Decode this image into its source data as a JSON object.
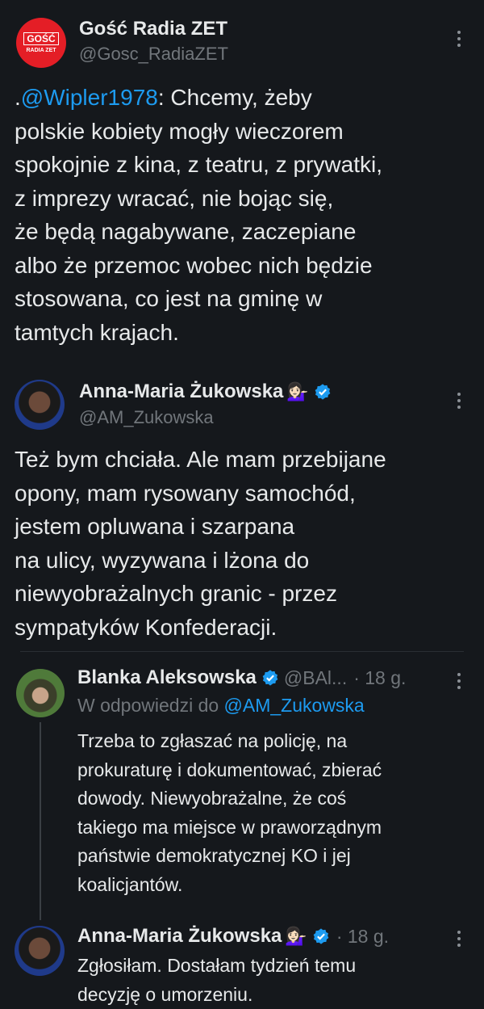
{
  "colors": {
    "background": "#15181c",
    "text": "#e7e9ea",
    "secondary": "#71767b",
    "accent": "#1d9bf0"
  },
  "tweet1": {
    "avatar_text_top": "GOŚĆ",
    "avatar_text_bottom": "RADIA ZET",
    "display_name": "Gość Radia ZET",
    "handle": "@Gosc_RadiaZET",
    "text_prefix": ".",
    "mention": "@Wipler1978",
    "lines": [
      ": Chcemy, żeby",
      "polskie kobiety mogły wieczorem",
      "spokojnie z kina, z teatru, z prywatki,",
      "z imprezy wracać, nie bojąc się,",
      "że będą nagabywane,  zaczepiane",
      "albo że przemoc wobec nich będzie",
      "stosowana, co jest na gminę w",
      "tamtych krajach."
    ]
  },
  "tweet2": {
    "display_name": "Anna-Maria Żukowska",
    "emoji": "💁🏻‍♀️",
    "handle": "@AM_Zukowska",
    "lines": [
      "Też bym chciała. Ale mam przebijane",
      "opony, mam rysowany samochód,",
      "jestem opluwana i szarpana",
      "na ulicy, wyzywana i lżona do",
      "niewyobrażalnych granic - przez",
      "sympatyków Konfederacji."
    ]
  },
  "reply1": {
    "display_name": "Blanka Aleksowska",
    "handle": "@BAl...",
    "time": "· 18 g.",
    "reply_to_prefix": "W odpowiedzi do ",
    "reply_to_mention": "@AM_Zukowska",
    "lines": [
      "Trzeba to zgłaszać na policję, na",
      "prokuraturę i dokumentować, zbierać",
      "dowody. Niewyobrażalne, że coś",
      "takiego ma miejsce w praworządnym",
      "państwie demokratycznej KO i jej",
      "koalicjantów."
    ]
  },
  "reply2": {
    "display_name": "Anna-Maria Żukowska",
    "emoji": "💁🏻‍♀️",
    "time": "· 18 g.",
    "lines": [
      "Zgłosiłam. Dostałam tydzień temu",
      "decyzję o umorzeniu."
    ]
  }
}
